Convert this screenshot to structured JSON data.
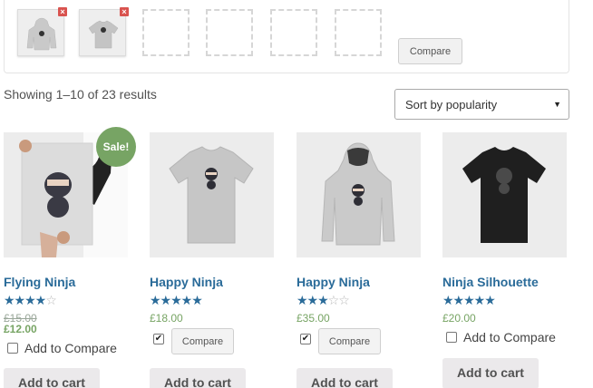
{
  "compare_bar": {
    "items": [
      {
        "name": "Hoodie thumbnail",
        "remove": "×"
      },
      {
        "name": "T-shirt thumbnail",
        "remove": "×"
      }
    ],
    "empty_slots": 4,
    "button_label": "Compare"
  },
  "shop": {
    "result_count": "Showing 1–10 of 23 results",
    "sort": {
      "selected": "Sort by popularity"
    }
  },
  "products": [
    {
      "title": "Flying Ninja",
      "rating": 4,
      "old_price": "£15.00",
      "price": "£12.00",
      "sale_badge": "Sale!",
      "compare_mode": "checkbox-label",
      "compare_label": "Add to Compare",
      "checked": false,
      "add_to_cart": "Add to cart",
      "image": "poster"
    },
    {
      "title": "Happy Ninja",
      "rating": 5,
      "price": "£18.00",
      "compare_mode": "checkbox-button",
      "compare_label": "Compare",
      "checked": true,
      "add_to_cart": "Add to cart",
      "image": "grey-tshirt"
    },
    {
      "title": "Happy Ninja",
      "rating": 3,
      "price": "£35.00",
      "compare_mode": "checkbox-button",
      "compare_label": "Compare",
      "checked": true,
      "add_to_cart": "Add to cart",
      "image": "hoodie"
    },
    {
      "title": "Ninja Silhouette",
      "rating": 5,
      "price": "£20.00",
      "compare_mode": "checkbox-label",
      "compare_label": "Add to Compare",
      "checked": false,
      "add_to_cart": "Add to cart",
      "image": "black-tshirt"
    }
  ],
  "colors": {
    "link": "#2a6b99",
    "price": "#77a464",
    "sale": "#77a464"
  }
}
